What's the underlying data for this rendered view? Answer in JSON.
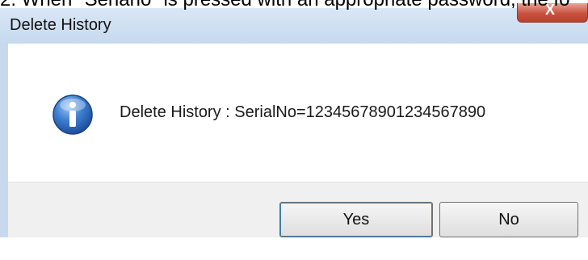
{
  "doc": {
    "text": "2.    When \"Senario\" is pressed with an appropriate password, the fo"
  },
  "dialog": {
    "title": "Delete History",
    "close_label": "X",
    "message": "Delete History : SerialNo=12345678901234567890",
    "icon": "info-icon"
  },
  "buttons": {
    "yes_label": "Yes",
    "no_label": "No"
  }
}
